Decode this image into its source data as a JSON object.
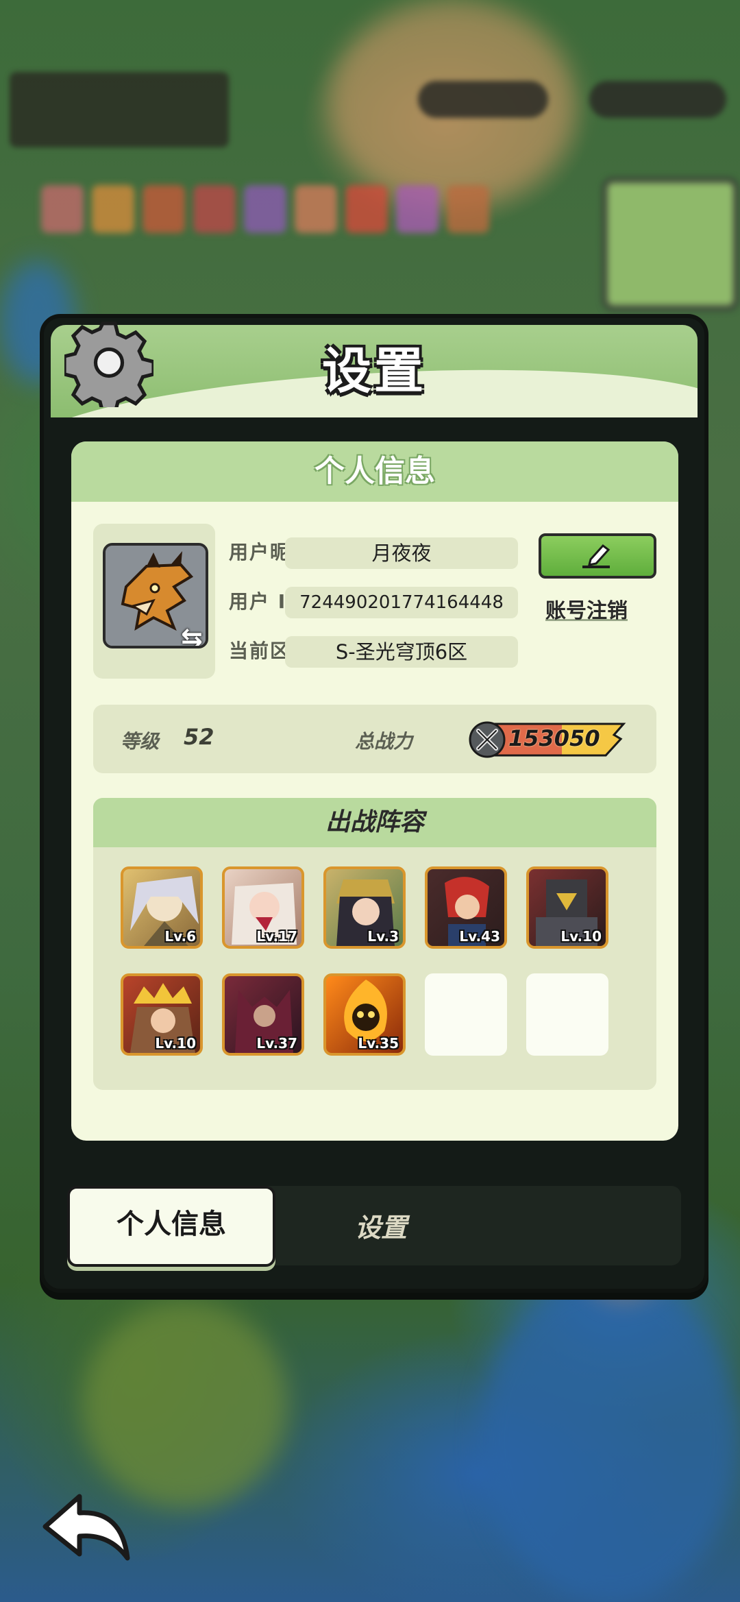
{
  "window": {
    "title": "设置"
  },
  "profile": {
    "section_title": "个人信息",
    "nickname_label": "用户昵称",
    "nickname": "月夜夜",
    "id_label": "用户  ID",
    "user_id": "724490201774164448",
    "server_label": "当前区服",
    "server": "S-圣光穹顶6区",
    "cancel_account": "账号注销"
  },
  "stats": {
    "level_label": "等级",
    "level": "52",
    "power_label": "总战力",
    "power": "153050"
  },
  "lineup": {
    "title": "出战阵容",
    "heroes": [
      {
        "level": "Lv.6"
      },
      {
        "level": "Lv.17"
      },
      {
        "level": "Lv.3"
      },
      {
        "level": "Lv.43"
      },
      {
        "level": "Lv.10"
      },
      {
        "level": "Lv.10"
      },
      {
        "level": "Lv.37"
      },
      {
        "level": "Lv.35"
      }
    ]
  },
  "tabs": [
    {
      "label": "个人信息",
      "active": true
    },
    {
      "label": "设置",
      "active": false
    }
  ],
  "icons": {
    "settings": "gear-icon",
    "edit": "pencil-icon",
    "swap": "swap-icon",
    "power": "crossed-swords-icon",
    "back": "back-arrow-icon"
  },
  "colors": {
    "header_green": "#8cbd70",
    "card_bg": "#f4f9df",
    "hero_border": "#d9962d",
    "edit_button": "#6fbd48"
  }
}
